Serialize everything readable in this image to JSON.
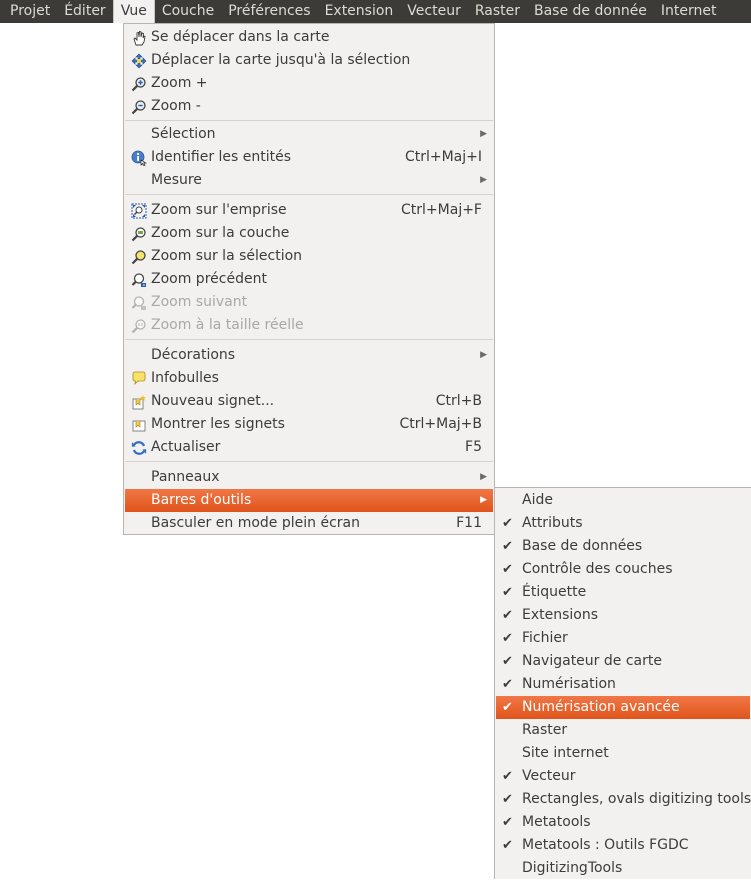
{
  "menubar": {
    "items": [
      "Projet",
      "Éditer",
      "Vue",
      "Couche",
      "Préférences",
      "Extension",
      "Vecteur",
      "Raster",
      "Base de donnée",
      "Internet"
    ]
  },
  "vue_menu": {
    "items": [
      {
        "label": "Se déplacer dans la carte",
        "icon": "pan-hand-icon"
      },
      {
        "label": "Déplacer la carte jusqu'à la sélection",
        "icon": "pan-to-selection-icon"
      },
      {
        "label": "Zoom +",
        "icon": "zoom-in-icon"
      },
      {
        "label": "Zoom -",
        "icon": "zoom-out-icon"
      },
      {
        "label": "Sélection",
        "submenu": true
      },
      {
        "label": "Identifier les entités",
        "shortcut": "Ctrl+Maj+I",
        "icon": "identify-icon"
      },
      {
        "label": "Mesure",
        "submenu": true
      },
      {
        "label": "Zoom sur l'emprise",
        "shortcut": "Ctrl+Maj+F",
        "icon": "zoom-full-icon"
      },
      {
        "label": "Zoom sur la couche",
        "icon": "zoom-layer-icon"
      },
      {
        "label": "Zoom sur la sélection",
        "icon": "zoom-selection-icon"
      },
      {
        "label": "Zoom précédent",
        "icon": "zoom-last-icon"
      },
      {
        "label": "Zoom suivant",
        "icon": "zoom-next-icon",
        "disabled": true
      },
      {
        "label": "Zoom à la taille réelle",
        "icon": "zoom-actual-size-icon",
        "disabled": true
      },
      {
        "label": "Décorations",
        "submenu": true
      },
      {
        "label": "Infobulles",
        "icon": "map-tips-icon"
      },
      {
        "label": "Nouveau signet...",
        "shortcut": "Ctrl+B",
        "icon": "new-bookmark-icon"
      },
      {
        "label": "Montrer les signets",
        "shortcut": "Ctrl+Maj+B",
        "icon": "show-bookmarks-icon"
      },
      {
        "label": "Actualiser",
        "shortcut": "F5",
        "icon": "refresh-icon"
      },
      {
        "label": "Panneaux",
        "submenu": true
      },
      {
        "label": "Barres d'outils",
        "submenu": true,
        "highlighted": true
      },
      {
        "label": "Basculer en mode plein écran",
        "shortcut": "F11"
      }
    ]
  },
  "toolbars_menu": {
    "items": [
      {
        "label": "Aide",
        "checked": false
      },
      {
        "label": "Attributs",
        "checked": true
      },
      {
        "label": "Base de données",
        "checked": true
      },
      {
        "label": "Contrôle des couches",
        "checked": true
      },
      {
        "label": "Étiquette",
        "checked": true
      },
      {
        "label": "Extensions",
        "checked": true
      },
      {
        "label": "Fichier",
        "checked": true
      },
      {
        "label": "Navigateur de carte",
        "checked": true
      },
      {
        "label": "Numérisation",
        "checked": true
      },
      {
        "label": "Numérisation avancée",
        "checked": true,
        "highlighted": true
      },
      {
        "label": "Raster",
        "checked": false
      },
      {
        "label": "Site internet",
        "checked": false
      },
      {
        "label": "Vecteur",
        "checked": true
      },
      {
        "label": "Rectangles, ovals digitizing tools",
        "checked": true
      },
      {
        "label": "Metatools",
        "checked": true
      },
      {
        "label": "Metatools : Outils FGDC",
        "checked": true
      },
      {
        "label": "DigitizingTools",
        "checked": false
      }
    ]
  },
  "colors": {
    "menubar_bg": "#3c3b37",
    "menu_bg": "#f2f1f0",
    "highlight": "#e95d20"
  }
}
